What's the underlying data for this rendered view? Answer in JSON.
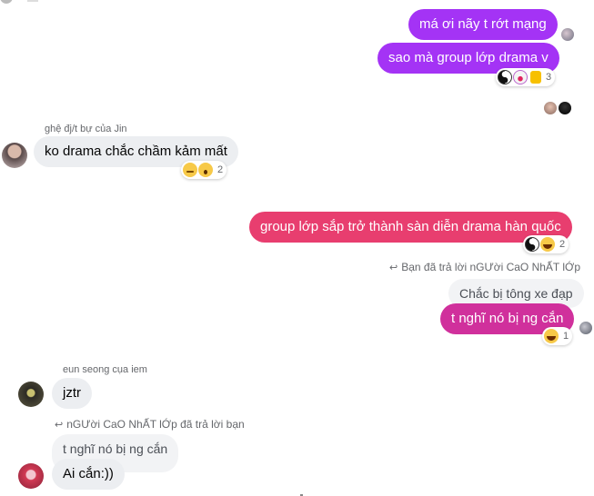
{
  "messages": {
    "m1": {
      "text": "má ơi nãy t rớt mạng"
    },
    "m2": {
      "text": "sao mà group lớp drama v",
      "reaction_count": "3"
    },
    "m3": {
      "sender": "ghệ đj/t bự của Jin",
      "text": "ko drama chắc chầm kảm mất",
      "reaction_count": "2"
    },
    "m4": {
      "text": "group lớp sắp trở thành sàn diễn drama hàn quốc",
      "reaction_count": "2"
    },
    "m5": {
      "reply_note": "Bạn đã trả lời nGƯời CaO NhẤT lỚp",
      "quoted": "Chắc bị tông xe đạp",
      "text": "t nghĩ nó bị ng cắn",
      "reaction_count": "1"
    },
    "m6": {
      "sender": "eun seong cụa iem",
      "text": "jztr"
    },
    "m7": {
      "reply_note": "nGƯời CaO NhẤT lỚp đã trả lời bạn",
      "quoted": "t nghĩ nó bị ng cắn",
      "text": "Ai cắn:))"
    }
  },
  "icons": {
    "reply": "reply-arrow-icon",
    "reactions": [
      "yin-yang-icon",
      "clown-icon",
      "thumbs-up-icon",
      "sad-face-icon",
      "wow-face-icon",
      "laughing-face-icon"
    ]
  },
  "colors": {
    "purple": "#a433f5",
    "pink": "#e83e6f",
    "magenta": "#d0309c",
    "grey_bubble": "#eceef1"
  }
}
